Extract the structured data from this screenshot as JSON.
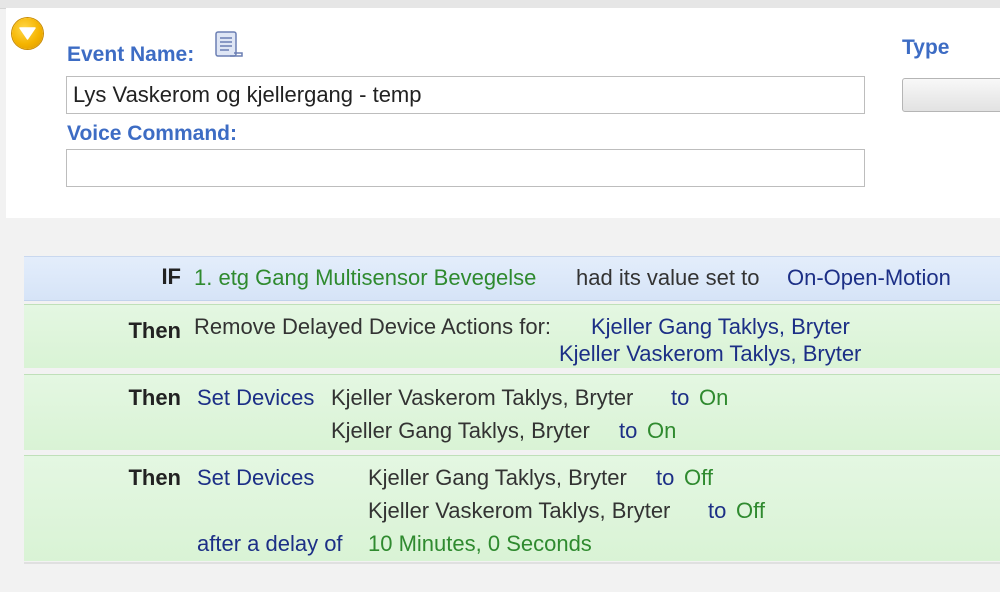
{
  "header": {
    "event_name_label": "Event Name:",
    "event_name_value": "Lys Vaskerom og kjellergang - temp",
    "voice_command_label": "Voice Command:",
    "voice_command_value": "",
    "type_label": "Type"
  },
  "rules": {
    "if_row": {
      "keyword": "IF",
      "device": "1. etg Gang Multisensor Bevegelse",
      "phrase": "had its value set to",
      "value": "On-Open-Motion"
    },
    "then1": {
      "keyword": "Then",
      "action": "Remove Delayed Device Actions for:",
      "devices": [
        "Kjeller Gang Taklys, Bryter",
        "Kjeller Vaskerom Taklys, Bryter"
      ]
    },
    "then2": {
      "keyword": "Then",
      "action": "Set Devices",
      "items": [
        {
          "device": "Kjeller Vaskerom Taklys, Bryter",
          "to": "to",
          "state": "On"
        },
        {
          "device": "Kjeller Gang Taklys, Bryter",
          "to": "to",
          "state": "On"
        }
      ]
    },
    "then3": {
      "keyword": "Then",
      "action": "Set Devices",
      "items": [
        {
          "device": "Kjeller Gang Taklys, Bryter",
          "to": "to",
          "state": "Off"
        },
        {
          "device": "Kjeller Vaskerom Taklys, Bryter",
          "to": "to",
          "state": "Off"
        }
      ],
      "delay_label": "after a delay of",
      "delay_value": "10 Minutes, 0 Seconds"
    }
  },
  "colors": {
    "label_blue": "#3d6cc4",
    "device_green": "#2f8a2f",
    "keyword_navy": "#1c2f86",
    "if_bg": "#dbe7f8",
    "then_bg": "#dcf4d8"
  },
  "icons": {
    "collapse": "chevron-down-icon",
    "edit": "notepad-icon"
  }
}
